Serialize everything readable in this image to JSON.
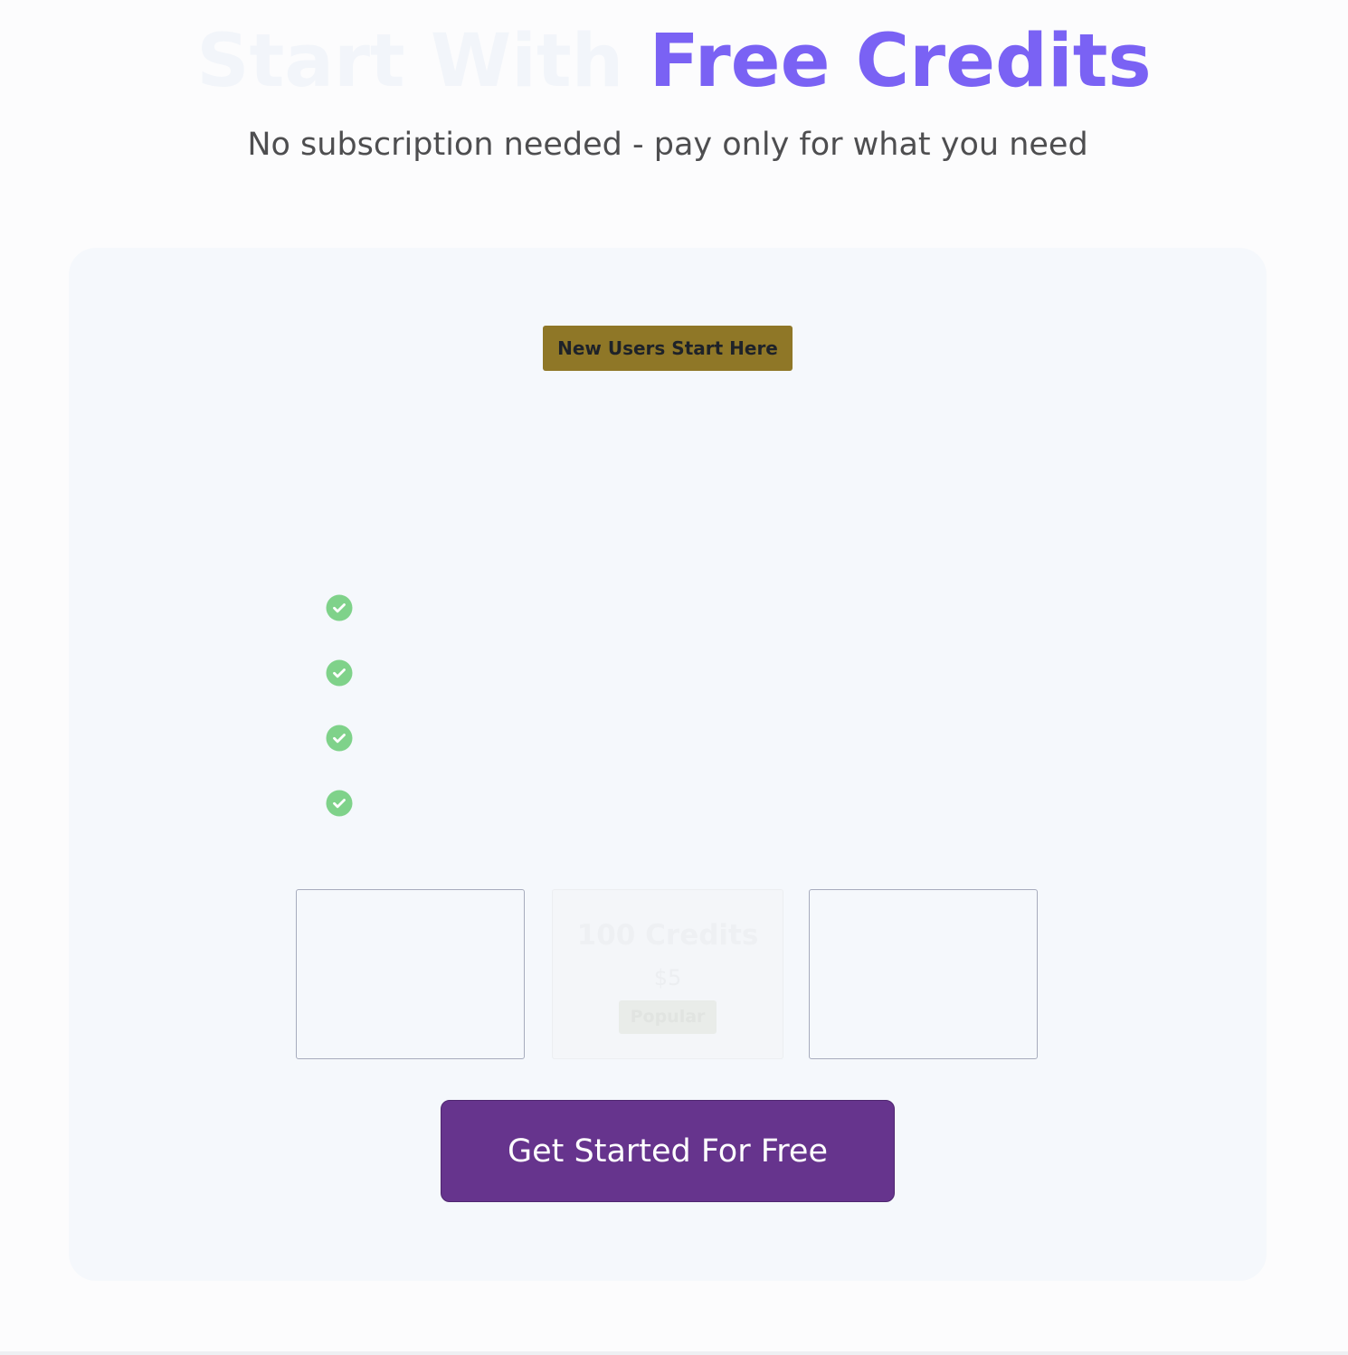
{
  "hero": {
    "title_lead": "Start With",
    "title_accent": "Free Credits",
    "subtitle": "No subscription needed - pay only for what you need"
  },
  "card": {
    "badge": "New Users Start Here",
    "features": [
      {
        "icon": "check-circle-icon",
        "text": ""
      },
      {
        "icon": "check-circle-icon",
        "text": ""
      },
      {
        "icon": "check-circle-icon",
        "text": ""
      },
      {
        "icon": "check-circle-icon",
        "text": ""
      }
    ],
    "packs": [
      {
        "title": "",
        "price": "",
        "tag": ""
      },
      {
        "title": "100 Credits",
        "price": "$5",
        "tag": "Popular"
      },
      {
        "title": "",
        "price": "",
        "tag": ""
      }
    ],
    "cta_label": "Get Started For Free"
  },
  "colors": {
    "accent": "#7a62f4",
    "badge_bg": "#8f7727",
    "check_green": "#7fd28a",
    "cta_bg": "#66348d",
    "card_bg": "#f5f8fc"
  }
}
